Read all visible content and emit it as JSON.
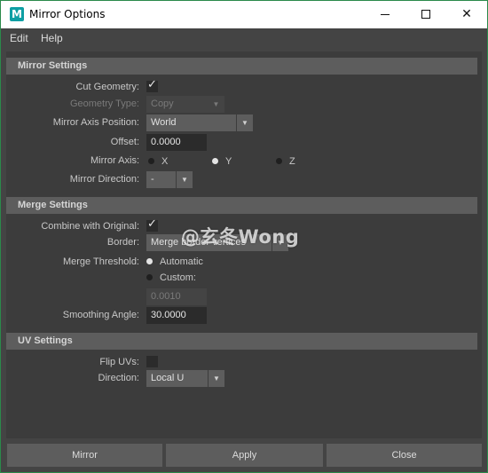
{
  "window": {
    "title": "Mirror Options",
    "app_icon_letter": "M"
  },
  "window_controls": {
    "close_glyph": "✕"
  },
  "menu": {
    "items": [
      "Edit",
      "Help"
    ]
  },
  "mirror_settings": {
    "header": "Mirror Settings",
    "cut_geometry_label": "Cut Geometry:",
    "cut_geometry_checked": true,
    "geometry_type_label": "Geometry Type:",
    "geometry_type_value": "Copy",
    "mirror_axis_position_label": "Mirror Axis Position:",
    "mirror_axis_position_value": "World",
    "offset_label": "Offset:",
    "offset_value": "0.0000",
    "mirror_axis_label": "Mirror Axis:",
    "mirror_axis_options": [
      "X",
      "Y",
      "Z"
    ],
    "mirror_axis_selected": "Y",
    "mirror_direction_label": "Mirror Direction:",
    "mirror_direction_value": "-"
  },
  "merge_settings": {
    "header": "Merge Settings",
    "combine_label": "Combine with Original:",
    "combine_checked": true,
    "border_label": "Border:",
    "border_value": "Merge border vertices",
    "merge_threshold_label": "Merge Threshold:",
    "threshold_options": [
      "Automatic",
      "Custom:"
    ],
    "threshold_selected": "Automatic",
    "custom_value": "0.0010",
    "smoothing_angle_label": "Smoothing Angle:",
    "smoothing_angle_value": "30.0000"
  },
  "uv_settings": {
    "header": "UV Settings",
    "flip_uvs_label": "Flip UVs:",
    "flip_uvs_checked": false,
    "direction_label": "Direction:",
    "direction_value": "Local U"
  },
  "watermark": "@玄冬Wong",
  "footer": {
    "mirror_label": "Mirror",
    "apply_label": "Apply",
    "close_label": "Close"
  },
  "icons": [
    "check-icon",
    "chevron-down-icon",
    "minimize-icon",
    "maximize-icon",
    "close-icon"
  ]
}
